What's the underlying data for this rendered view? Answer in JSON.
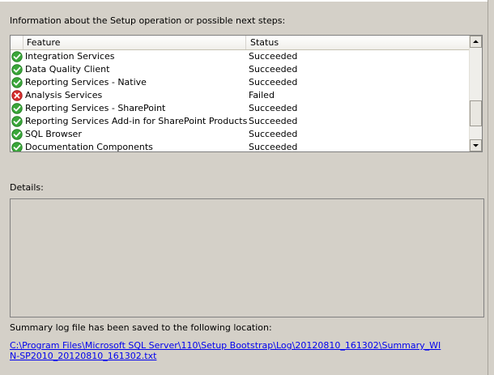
{
  "info_label": "Information about the Setup operation or possible next steps:",
  "table": {
    "columns": [
      "Feature",
      "Status"
    ],
    "rows": [
      {
        "feature": "Integration Services",
        "status": "Succeeded",
        "icon": "success-icon"
      },
      {
        "feature": "Data Quality Client",
        "status": "Succeeded",
        "icon": "success-icon"
      },
      {
        "feature": "Reporting Services - Native",
        "status": "Succeeded",
        "icon": "success-icon"
      },
      {
        "feature": "Analysis Services",
        "status": "Failed",
        "icon": "error-icon"
      },
      {
        "feature": "Reporting Services - SharePoint",
        "status": "Succeeded",
        "icon": "success-icon"
      },
      {
        "feature": "Reporting Services Add-in for SharePoint Products",
        "status": "Succeeded",
        "icon": "success-icon"
      },
      {
        "feature": "SQL Browser",
        "status": "Succeeded",
        "icon": "success-icon"
      },
      {
        "feature": "Documentation Components",
        "status": "Succeeded",
        "icon": "success-icon"
      }
    ]
  },
  "details_label": "Details:",
  "summary_label": "Summary log file has been saved to the following location:",
  "summary_link": "C:\\Program Files\\Microsoft SQL Server\\110\\Setup Bootstrap\\Log\\20120810_161302\\Summary_WIN-SP2010_20120810_161302.txt",
  "colors": {
    "success": "#3aa63a",
    "error": "#d62d2d",
    "link": "#0000ee",
    "background": "#d4d0c8"
  }
}
